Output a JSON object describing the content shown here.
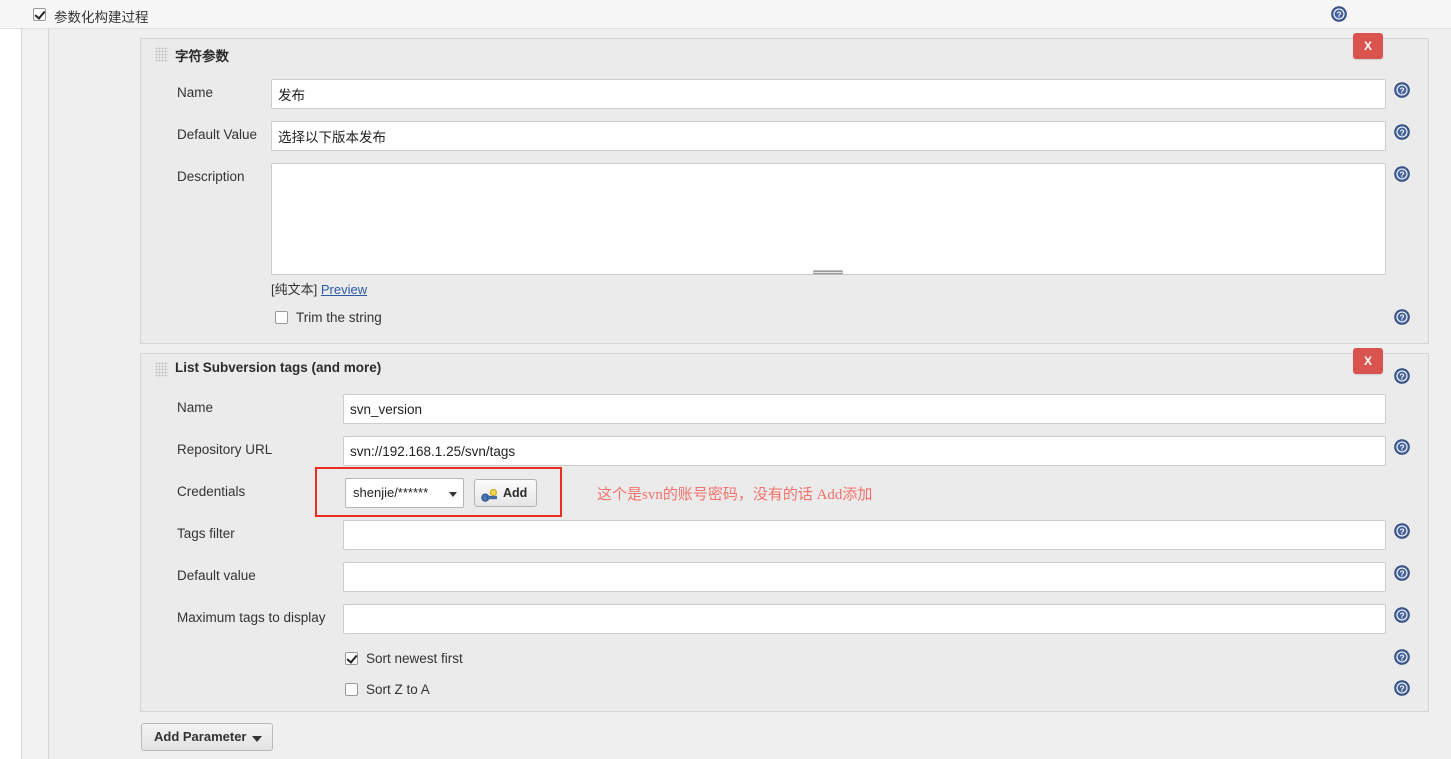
{
  "topbar": {
    "label": "参数化构建过程",
    "checked": true,
    "help_icon": "help-icon"
  },
  "sections": [
    {
      "id": "string-parameter",
      "title": "字符参数",
      "delete_label": "X",
      "fields": {
        "name_label": "Name",
        "name_value": "发布",
        "default_label": "Default Value",
        "default_value": "选择以下版本发布",
        "description_label": "Description",
        "description_value": "",
        "markup_note": "[纯文本]",
        "preview_link": "Preview",
        "trim_label": "Trim the string",
        "trim_checked": false
      }
    },
    {
      "id": "list-subversion-tags",
      "title": "List Subversion tags (and more)",
      "delete_label": "X",
      "fields": {
        "name_label": "Name",
        "name_value": "svn_version",
        "repo_label": "Repository URL",
        "repo_value": "svn://192.168.1.25/svn/tags",
        "credentials_label": "Credentials",
        "credentials_value": "shenjie/******",
        "add_button_label": "Add",
        "tags_filter_label": "Tags filter",
        "tags_filter_value": "",
        "default_value_label": "Default value",
        "default_value_value": "",
        "max_tags_label": "Maximum tags to display",
        "max_tags_value": "",
        "sort_newest_label": "Sort newest first",
        "sort_newest_checked": true,
        "sort_za_label": "Sort Z to A",
        "sort_za_checked": false
      }
    }
  ],
  "annotation": {
    "text": "这个是svn的账号密码，没有的话 Add添加",
    "color": "#f4716b",
    "box_color": "#ee2b21"
  },
  "footer": {
    "add_parameter_label": "Add Parameter"
  },
  "colors": {
    "danger": "#d9534f",
    "help_blue": "#44629c",
    "panel_bg": "#ebebeb",
    "page_bg": "#efefef"
  }
}
